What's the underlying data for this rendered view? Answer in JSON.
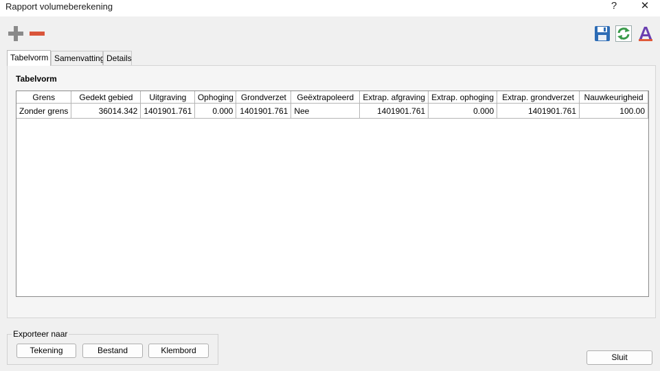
{
  "window": {
    "title": "Rapport volumeberekening",
    "help_label": "?",
    "close_label": "✕"
  },
  "toolbar": {
    "add_icon": "plus-icon",
    "remove_icon": "minus-icon",
    "save_icon": "save-icon",
    "refresh_icon": "refresh-icon",
    "font_icon": "font-icon",
    "colors": {
      "add": "#8a8a8a",
      "remove": "#d9553a",
      "save": "#2d6cb5",
      "refresh": "#3a9a4a",
      "font": "#6a3fb0"
    }
  },
  "tabs": [
    {
      "label": "Tabelvorm",
      "active": true
    },
    {
      "label": "Samenvatting",
      "active": false
    },
    {
      "label": "Details",
      "active": false
    }
  ],
  "panel": {
    "title": "Tabelvorm"
  },
  "table": {
    "columns": [
      "Grens",
      "Gedekt gebied",
      "Uitgraving",
      "Ophoging",
      "Grondverzet",
      "Geëxtrapoleerd",
      "Extrap. afgraving",
      "Extrap. ophoging",
      "Extrap. grondverzet",
      "Nauwkeurigheid"
    ],
    "rows": [
      [
        "Zonder grens",
        "36014.342",
        "1401901.761",
        "0.000",
        "1401901.761",
        "Nee",
        "1401901.761",
        "0.000",
        "1401901.761",
        "100.00"
      ]
    ]
  },
  "export": {
    "legend": "Exporteer naar",
    "tekening": "Tekening",
    "bestand": "Bestand",
    "klembord": "Klembord"
  },
  "close_button": "Sluit"
}
